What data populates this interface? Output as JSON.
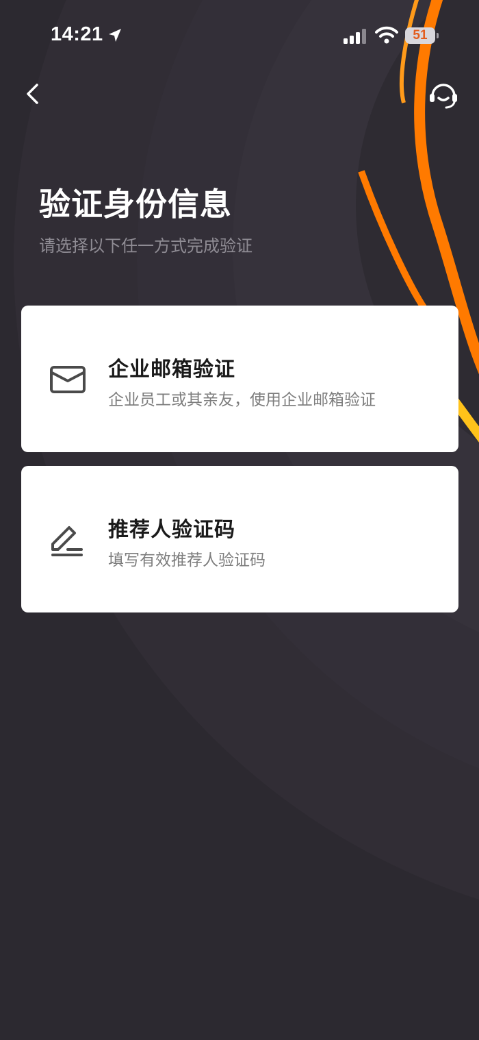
{
  "status_bar": {
    "time": "14:21",
    "battery": "51"
  },
  "nav": {
    "back_icon": "chevron-left-icon",
    "support_icon": "customer-service-headset-icon"
  },
  "header": {
    "title": "验证身份信息",
    "subtitle": "请选择以下任一方式完成验证"
  },
  "options": [
    {
      "icon": "envelope-icon",
      "title": "企业邮箱验证",
      "description": "企业员工或其亲友，使用企业邮箱验证"
    },
    {
      "icon": "edit-pen-icon",
      "title": "推荐人验证码",
      "description": "填写有效推荐人验证码"
    }
  ],
  "colors": {
    "background": "#2c2930",
    "accent_orange": "#ff7a00",
    "accent_yellow": "#ffc21a",
    "card_background": "#ffffff"
  }
}
